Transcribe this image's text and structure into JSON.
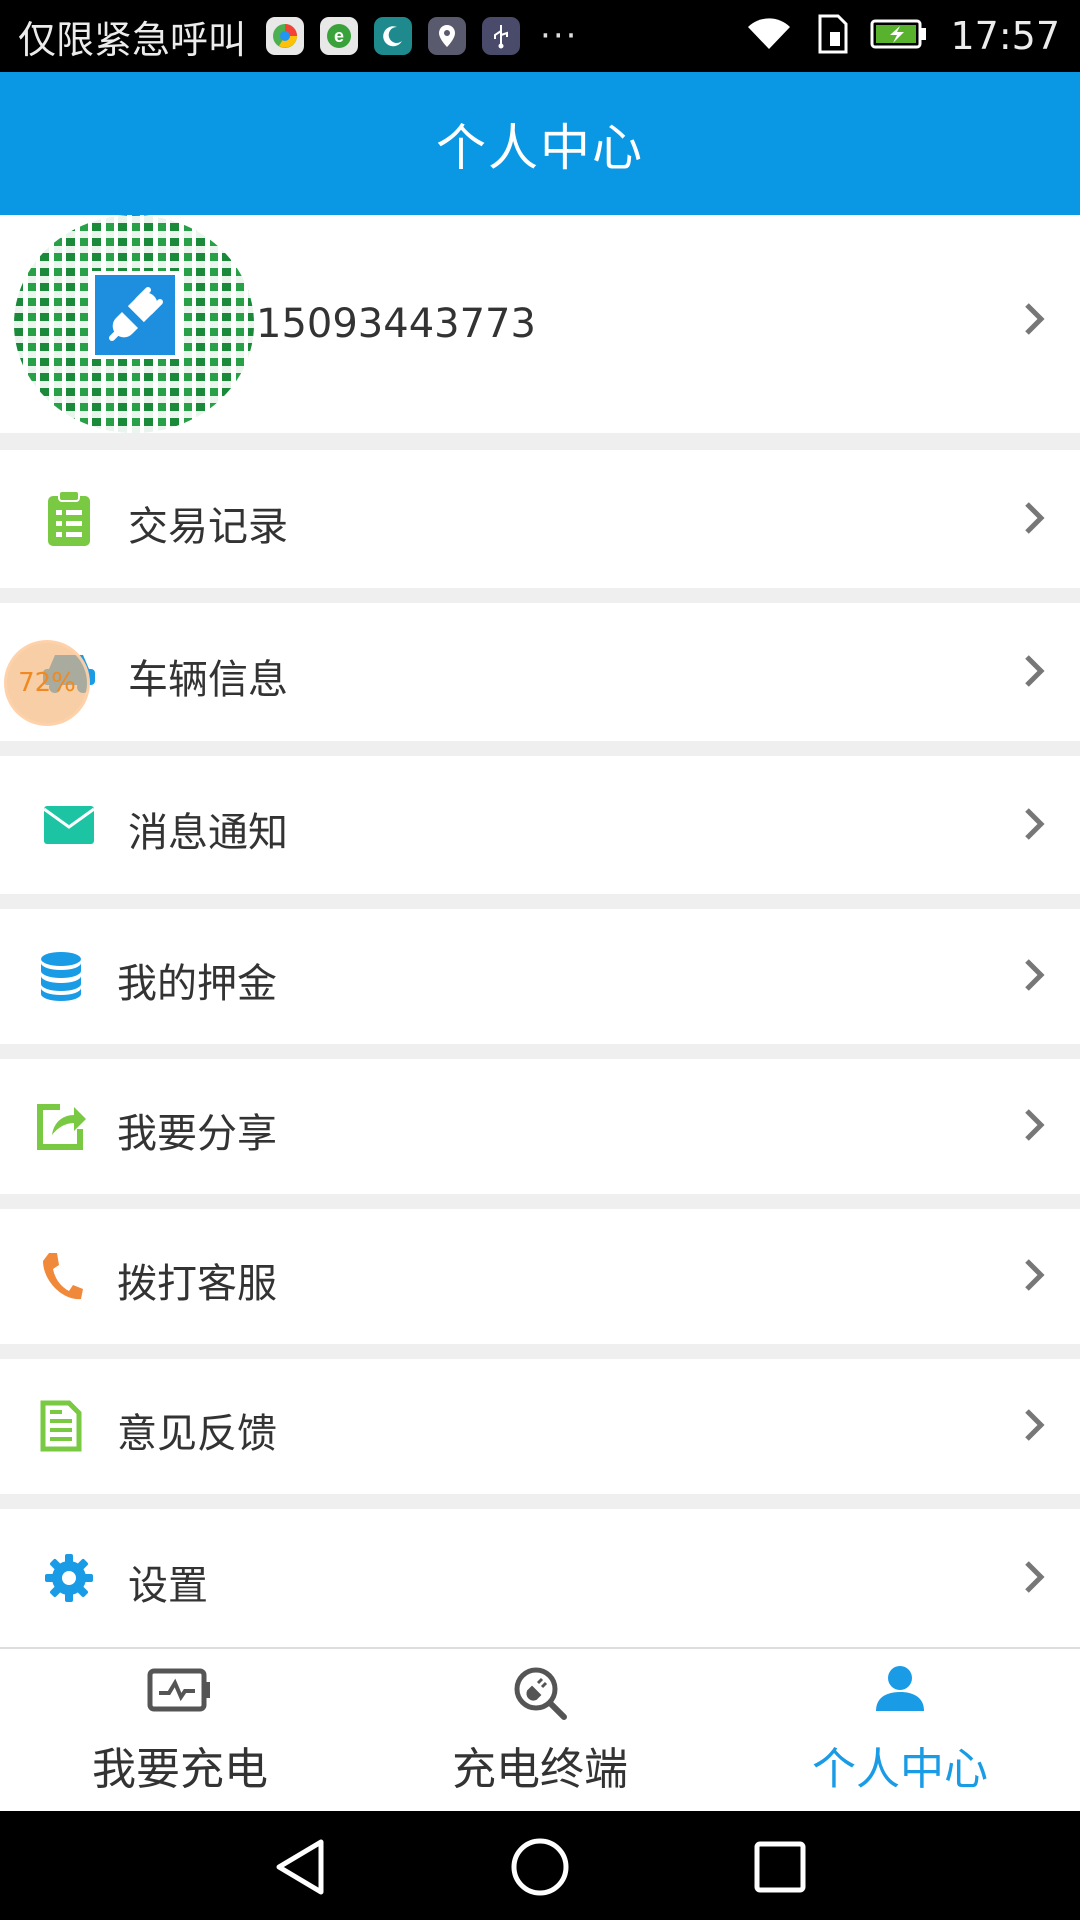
{
  "status_bar": {
    "carrier_text": "仅限紧急呼叫",
    "notification_icons": [
      "browser-icon",
      "e-browser-icon",
      "moon-icon",
      "location-icon",
      "usb-icon"
    ],
    "overflow": "···",
    "time": "17:57",
    "battery_charging": true
  },
  "title_bar": {
    "title": "个人中心"
  },
  "profile": {
    "phone": "15093443773"
  },
  "menu": {
    "items": [
      {
        "label": "交易记录",
        "icon": "clipboard-icon",
        "color": "#7ac943"
      },
      {
        "label": "车辆信息",
        "icon": "car-icon",
        "color": "#1a9be6"
      },
      {
        "label": "消息通知",
        "icon": "mail-icon",
        "color": "#1cc4a3"
      },
      {
        "label": "我的押金",
        "icon": "database-icon",
        "color": "#1a9be6"
      },
      {
        "label": "我要分享",
        "icon": "share-icon",
        "color": "#7ac943"
      },
      {
        "label": "拨打客服",
        "icon": "phone-icon",
        "color": "#f08a3a"
      },
      {
        "label": "意见反馈",
        "icon": "feedback-icon",
        "color": "#7ac943"
      },
      {
        "label": "设置",
        "icon": "gear-icon",
        "color": "#1a9be6"
      }
    ]
  },
  "floating_bubble": {
    "text": "72%"
  },
  "tabs": [
    {
      "label": "我要充电",
      "icon": "charge-icon",
      "active": false
    },
    {
      "label": "充电终端",
      "icon": "terminal-search-icon",
      "active": false
    },
    {
      "label": "个人中心",
      "icon": "person-icon",
      "active": true
    }
  ],
  "colors": {
    "brand": "#0a98e4",
    "active_tab": "#1a9be6"
  }
}
